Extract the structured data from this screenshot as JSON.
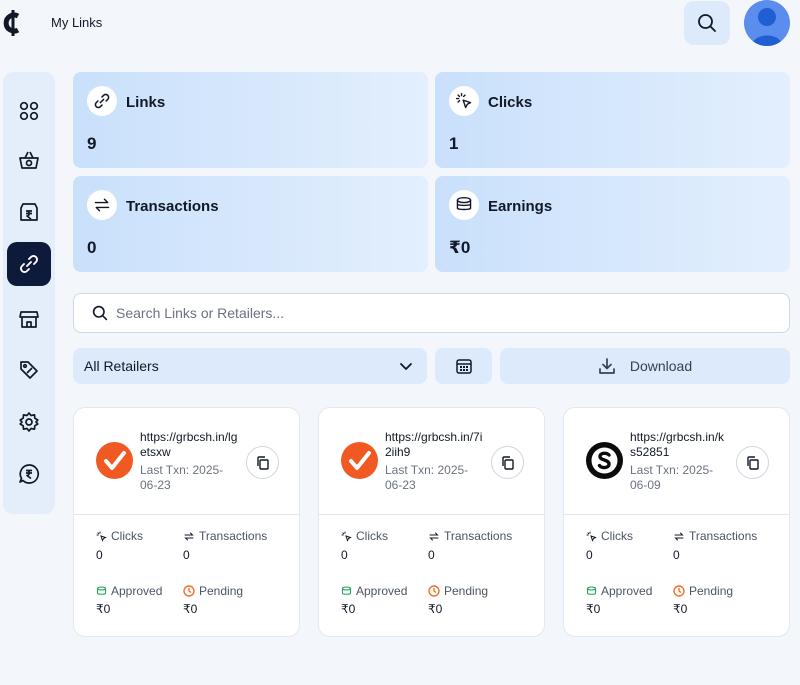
{
  "header": {
    "title": "My Links",
    "logo_icon": "cent-logo-icon",
    "search_icon": "search-icon",
    "avatar_icon": "user-avatar-icon"
  },
  "sidebar": {
    "items": [
      {
        "icon": "grid-icon",
        "active": false
      },
      {
        "icon": "basket-icon",
        "active": false
      },
      {
        "icon": "wallet-icon",
        "active": false
      },
      {
        "icon": "link-icon",
        "active": true
      },
      {
        "icon": "store-icon",
        "active": false
      },
      {
        "icon": "tag-icon",
        "active": false
      },
      {
        "icon": "settings-icon",
        "active": false
      },
      {
        "icon": "rupee-chat-icon",
        "active": false
      }
    ]
  },
  "stats": [
    {
      "label": "Links",
      "value": "9",
      "icon": "link-icon"
    },
    {
      "label": "Clicks",
      "value": "1",
      "icon": "click-icon"
    },
    {
      "label": "Transactions",
      "value": "0",
      "icon": "swap-icon"
    },
    {
      "label": "Earnings",
      "value": "₹0",
      "icon": "coins-icon"
    }
  ],
  "search": {
    "placeholder": "Search Links or Retailers...",
    "value": ""
  },
  "filters": {
    "retailer_selected": "All Retailers",
    "download_label": "Download"
  },
  "cards": [
    {
      "url": "https://grbcsh.in/lgetsxw",
      "last_txn": "Last Txn: 2025-06-23",
      "logo": "orange-check",
      "clicks_label": "Clicks",
      "clicks": "0",
      "transactions_label": "Transactions",
      "transactions": "0",
      "approved_label": "Approved",
      "approved": "₹0",
      "pending_label": "Pending",
      "pending": "₹0"
    },
    {
      "url": "https://grbcsh.in/7i2iih9",
      "last_txn": "Last Txn: 2025-06-23",
      "logo": "orange-check",
      "clicks_label": "Clicks",
      "clicks": "0",
      "transactions_label": "Transactions",
      "transactions": "0",
      "approved_label": "Approved",
      "approved": "₹0",
      "pending_label": "Pending",
      "pending": "₹0"
    },
    {
      "url": "https://grbcsh.in/ks52851",
      "last_txn": "Last Txn: 2025-06-09",
      "logo": "black-s",
      "clicks_label": "Clicks",
      "clicks": "0",
      "transactions_label": "Transactions",
      "transactions": "0",
      "approved_label": "Approved",
      "approved": "₹0",
      "pending_label": "Pending",
      "pending": "₹0"
    }
  ],
  "colors": {
    "accent_dark": "#0e1a3a",
    "light_blue": "#dceafb",
    "orange": "#f05a22",
    "approved_green": "#22a55a",
    "pending_orange": "#f0702a"
  }
}
